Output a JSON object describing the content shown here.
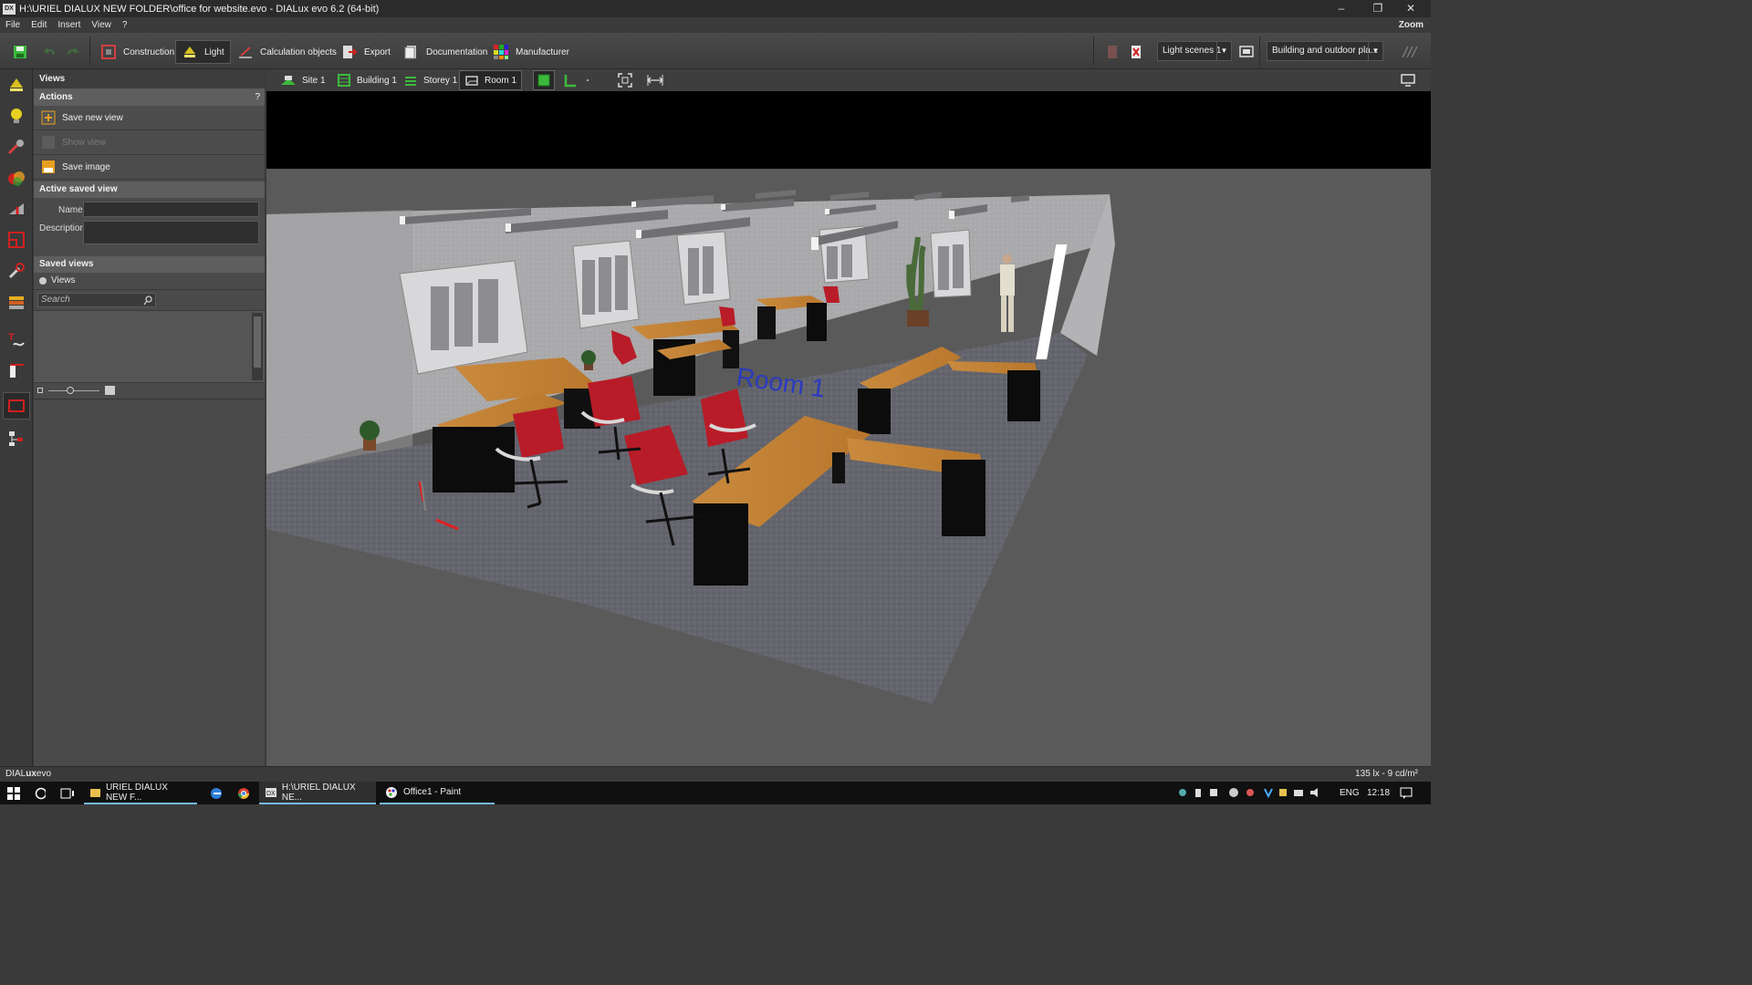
{
  "window": {
    "title": "H:\\URIEL DIALUX NEW FOLDER\\office for website.evo - DIALux evo 6.2  (64-bit)",
    "app_icon_label": "DX",
    "controls": {
      "minimize": "–",
      "restore": "❐",
      "close": "✕"
    }
  },
  "menu": {
    "items": [
      "File",
      "Edit",
      "Insert",
      "View",
      "?"
    ],
    "zoom_label": "Zoom"
  },
  "toolbar": {
    "tabs": [
      {
        "label": "Construction",
        "icon": "construction-icon"
      },
      {
        "label": "Light",
        "icon": "lamp-icon",
        "active": true
      },
      {
        "label": "Calculation objects",
        "icon": "calculation-icon"
      },
      {
        "label": "Export",
        "icon": "export-icon"
      },
      {
        "label": "Documentation",
        "icon": "documentation-icon"
      },
      {
        "label": "Manufacturer",
        "icon": "manufacturer-icon"
      }
    ],
    "light_scene": "Light scenes 1",
    "view_mode": "Building and outdoor pla..."
  },
  "rail": {
    "tools": [
      "luminaire-tool-icon",
      "bulb-tool-icon",
      "light-edit-tool-icon",
      "color-tool-icon",
      "measure-tool-icon",
      "room-tool-icon",
      "wrench-tool-icon",
      "layers-tool-icon",
      "text-tool-icon",
      "plan-tool-icon",
      "view-tool-icon",
      "tree-tool-icon"
    ],
    "active_index": 10
  },
  "panel": {
    "title": "Views",
    "actions_header": "Actions",
    "help_label": "?",
    "actions": [
      {
        "label": "Save new view",
        "enabled": true
      },
      {
        "label": "Show view",
        "enabled": false
      },
      {
        "label": "Save image",
        "enabled": true
      }
    ],
    "active_saved_view_header": "Active saved view",
    "name_label": "Name",
    "name_value": "",
    "description_label": "Description",
    "description_value": "",
    "saved_views_header": "Saved views",
    "views_radio_label": "Views",
    "search_placeholder": "Search"
  },
  "breadcrumbs": [
    {
      "label": "Site 1"
    },
    {
      "label": "Building 1"
    },
    {
      "label": "Storey 1"
    },
    {
      "label": "Room 1",
      "active": true
    }
  ],
  "scene": {
    "floor_label": "Room 1"
  },
  "status": {
    "brand_left": "DIAL",
    "brand_right": "ux",
    "brand_suffix": "evo",
    "readout": "135 lx - 9 cd/m²"
  },
  "taskbar": {
    "items": [
      {
        "label": "URIEL DIALUX NEW F...",
        "icon": "folder-icon"
      },
      {
        "label": "",
        "icon": "edge-icon"
      },
      {
        "label": "",
        "icon": "chrome-icon"
      },
      {
        "label": "H:\\URIEL DIALUX NE...",
        "icon": "dialux-icon",
        "active": true
      },
      {
        "label": "Office1 - Paint",
        "icon": "paint-icon"
      }
    ],
    "language": "ENG",
    "time": "12:18"
  },
  "colors": {
    "accent_green": "#3cb93c",
    "lamp_yellow": "#d8c020",
    "red": "#c41e2a",
    "desk": "#c98a3e"
  }
}
